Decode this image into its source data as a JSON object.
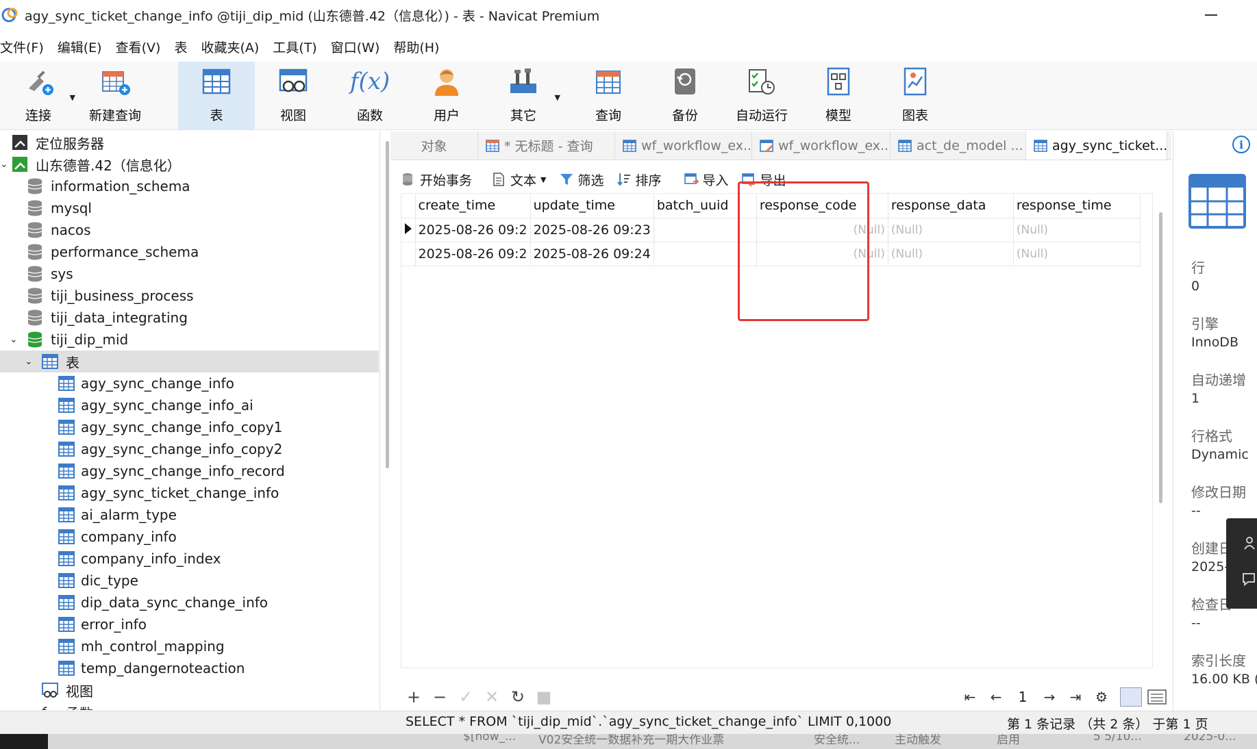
{
  "window": {
    "title": "agy_sync_ticket_change_info @tiji_dip_mid (山东德普.42（信息化）) - 表 - Navicat Premium"
  },
  "menu": [
    "文件(F)",
    "编辑(E)",
    "查看(V)",
    "表",
    "收藏夹(A)",
    "工具(T)",
    "窗口(W)",
    "帮助(H)"
  ],
  "toolbar": {
    "connect": "连接",
    "new_query": "新建查询",
    "table": "表",
    "view": "视图",
    "function": "函数",
    "user": "用户",
    "other": "其它",
    "query": "查询",
    "backup": "备份",
    "auto_run": "自动运行",
    "model": "模型",
    "chart": "图表"
  },
  "sidebar": {
    "locate_server": "定位服务器",
    "connection": "山东德普.42（信息化）",
    "databases": [
      "information_schema",
      "mysql",
      "nacos",
      "performance_schema",
      "sys",
      "tiji_business_process",
      "tiji_data_integrating",
      "tiji_dip_mid"
    ],
    "tables_node": "表",
    "tables": [
      "agy_sync_change_info",
      "agy_sync_change_info_ai",
      "agy_sync_change_info_copy1",
      "agy_sync_change_info_copy2",
      "agy_sync_change_info_record",
      "agy_sync_ticket_change_info",
      "ai_alarm_type",
      "company_info",
      "company_info_index",
      "dic_type",
      "dip_data_sync_change_info",
      "error_info",
      "mh_control_mapping",
      "temp_dangernoteaction"
    ],
    "views_node": "视图",
    "functions_node": "函数"
  },
  "tabs": {
    "objects": "对象",
    "untitled_query": "* 无标题 - 查询",
    "wf1": "wf_workflow_ex...",
    "wf2": "wf_workflow_ex...",
    "act": "act_de_model ...",
    "agy": "agy_sync_ticket..."
  },
  "subtoolbar": {
    "begin_tx": "开始事务",
    "text": "文本",
    "filter": "筛选",
    "sort": "排序",
    "import": "导入",
    "export": "导出"
  },
  "grid": {
    "columns": [
      "create_time",
      "update_time",
      "batch_uuid",
      "response_code",
      "response_data",
      "response_time"
    ],
    "rows": [
      [
        "2025-08-26 09:2",
        "2025-08-26 09:23",
        "",
        "(Null)",
        "(Null)",
        "(Null)"
      ],
      [
        "2025-08-26 09:2",
        "2025-08-26 09:24",
        "",
        "(Null)",
        "(Null)",
        "(Null)"
      ]
    ]
  },
  "pager": {
    "page": "1"
  },
  "status": {
    "sql": "SELECT * FROM `tiji_dip_mid`.`agy_sync_ticket_change_info` LIMIT 0,1000",
    "records": "第 1 条记录 （共 2 条） 于第 1 页"
  },
  "underlay": {
    "t1": "$[now_...",
    "t2": "V02安全统一数据补充一期大作业票",
    "t3": "安全统...",
    "t4": "主动触发",
    "t5": "启用",
    "t6": "5 5/10...",
    "t7": "2025-0..."
  },
  "info": {
    "rows_label": "行",
    "rows_value": "0",
    "engine_label": "引擎",
    "engine_value": "InnoDB",
    "auto_inc_label": "自动递增",
    "auto_inc_value": "1",
    "row_format_label": "行格式",
    "row_format_value": "Dynamic",
    "modified_label": "修改日期",
    "modified_value": "--",
    "created_label": "创建日",
    "created_value": "2025-",
    "check_label": "检查日",
    "check_value": "--",
    "index_len_label": "索引长度",
    "index_len_value": "16.00 KB ("
  },
  "colors": {
    "accent": "#1976d2",
    "highlight": "#e53935",
    "db_green": "#2e9e3a"
  }
}
